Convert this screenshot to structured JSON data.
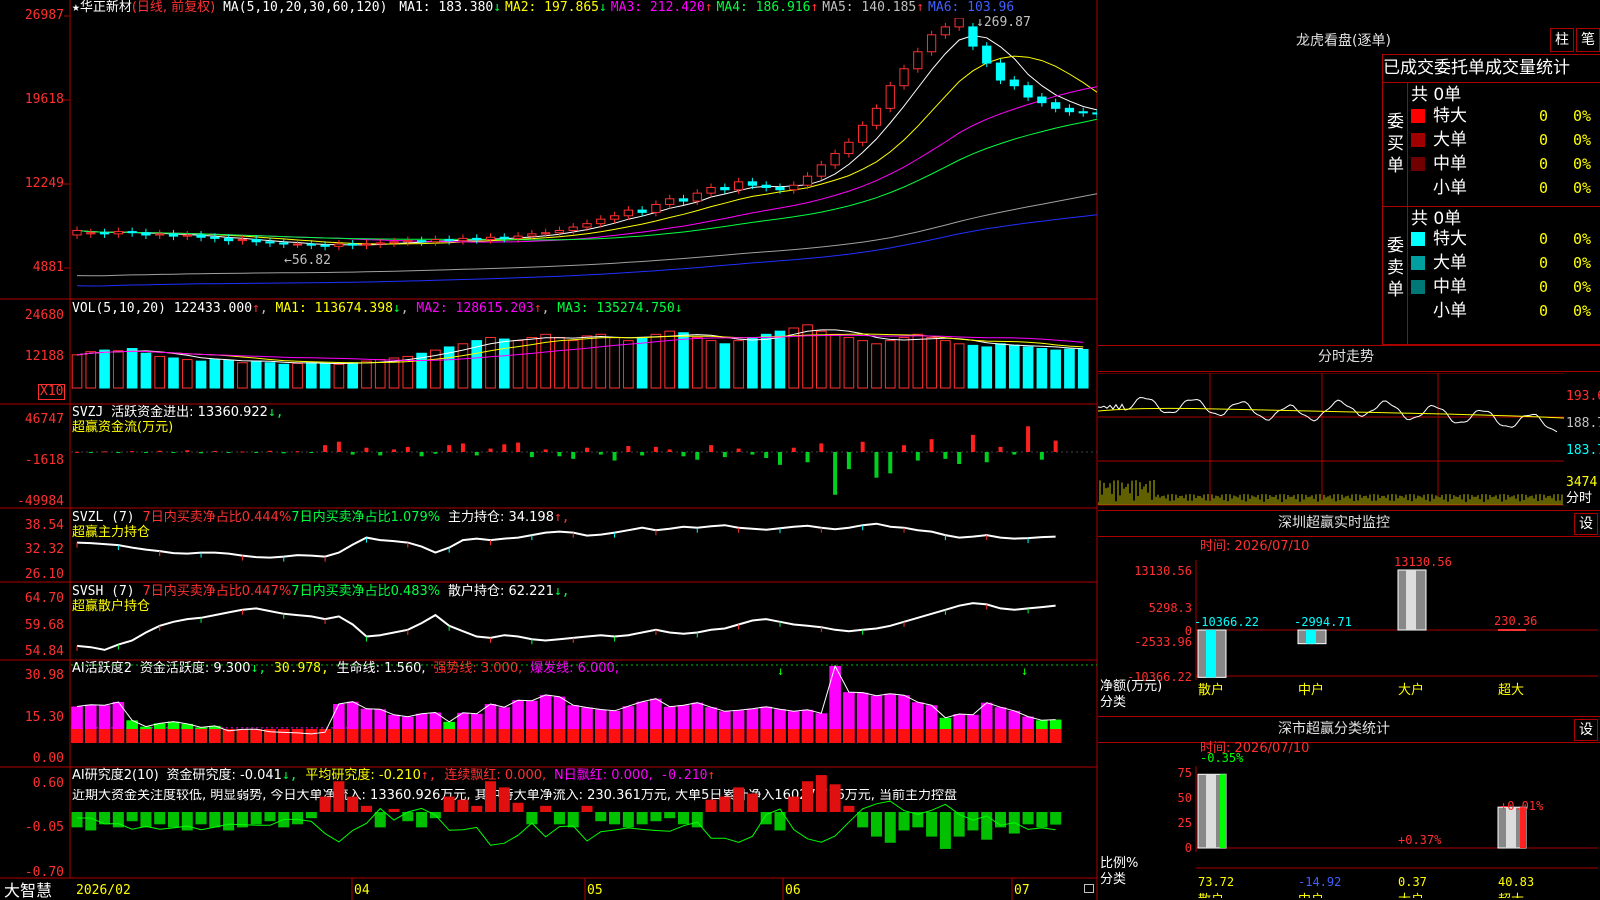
{
  "stock": {
    "name": "华正新材",
    "mode": "(日线, 前复权)",
    "star": "★"
  },
  "ma_line": {
    "head": "MA(5,10,20,30,60,120)",
    "items": [
      {
        "label": "MA1: 183.380",
        "arrow": "↓",
        "color": "#ffffff"
      },
      {
        "label": "MA2: 197.865",
        "arrow": "↓",
        "color": "#ffff00"
      },
      {
        "label": "MA3: 212.420",
        "arrow": "↑",
        "color": "#ff00ff"
      },
      {
        "label": "MA4: 186.916",
        "arrow": "↑",
        "color": "#00ff40"
      },
      {
        "label": "MA5: 140.185",
        "arrow": "↑",
        "color": "#c0c0c0"
      },
      {
        "label": "MA6: 103.96",
        "arrow": "",
        "color": "#4060ff"
      }
    ]
  },
  "price_axis": [
    "26987",
    "19618",
    "12249",
    "4881"
  ],
  "price_annot": {
    "high": "269.87",
    "low": "56.82"
  },
  "vol": {
    "head": "VOL(5,10,20)",
    "value": "122433.000",
    "value_arrow": "↑",
    "ma1": "MA1: 113674.398",
    "ma1_arrow": "↓",
    "ma2": "MA2: 128615.203",
    "ma2_arrow": "↑",
    "ma3": "MA3: 135274.750",
    "ma3_arrow": "↓",
    "axis": [
      "24680",
      "12188"
    ],
    "scale": "X10"
  },
  "svzj": {
    "name": "SVZJ",
    "text": "活跃资金进出: 13360.922",
    "arrow": "↓,",
    "sub": "超赢资金流(万元)",
    "axis": [
      "46747",
      "-1618",
      "-49984"
    ]
  },
  "svzl": {
    "name": "SVZL (7)",
    "t1": "7日内买卖净占比0.444%",
    "t2": "7日内买卖净占比1.079%",
    "t3": "主力持仓: 34.198",
    "arrow": "↑,",
    "sub": "超赢主力持仓",
    "axis": [
      "38.54",
      "32.32",
      "26.10"
    ]
  },
  "svsh": {
    "name": "SVSH (7)",
    "t1": "7日内买卖净占比0.447%",
    "t2": "7日内买卖净占比0.483%",
    "t3": "散户持仓: 62.221",
    "arrow": "↓,",
    "sub": "超赢散户持仓",
    "axis": [
      "64.70",
      "59.68",
      "54.84"
    ]
  },
  "ai1": {
    "name": "AI活跃度2",
    "t1": "资金活跃度: 9.300",
    "a1": "↓,",
    "t2": "30.978,",
    "t3": "生命线: 1.560,",
    "t4": "强势线: 3.000,",
    "t5": "爆发线: 6.000,",
    "axis": [
      "30.98",
      "15.30",
      "0.00"
    ]
  },
  "ai2": {
    "name": "AI研究度2(10)",
    "t1": "资金研究度: -0.041",
    "a1": "↓,",
    "t2": "平均研究度: -0.210",
    "a2": "↑,",
    "t3": "连续飘红: 0.000,",
    "t4": "N日飘红: 0.000,",
    "t5": "-0.210",
    "a5": "↑",
    "comment": "近期大资金关注度较低, 明显弱势, 今日大单净流入: 13360.926万元, 其中特大单净流入: 230.361万元, 大单5日累计净入16027.716万元, 当前主力控盘",
    "axis": [
      "0.60",
      "-0.05",
      "-0.70"
    ]
  },
  "date_axis": {
    "brand": "大智慧",
    "labels": [
      "2026/02",
      "04",
      "05",
      "06",
      "07"
    ]
  },
  "right": {
    "lhb_title": "龙虎看盘(逐单)",
    "btn_zhu": "柱",
    "btn_bi": "笔",
    "table_title": "已成交委托单成交量统计",
    "buy_label": [
      "委",
      "买",
      "单"
    ],
    "sell_label": [
      "委",
      "卖",
      "单"
    ],
    "buy_count": "共 0单",
    "sell_count": "共 0单",
    "buy_rows": [
      {
        "name": "特大",
        "color": "#ff0000",
        "val": "0",
        "pct": "0%"
      },
      {
        "name": "大单",
        "color": "#a00000",
        "val": "0",
        "pct": "0%"
      },
      {
        "name": "中单",
        "color": "#700000",
        "val": "0",
        "pct": "0%"
      },
      {
        "name": "小单",
        "color": "",
        "val": "0",
        "pct": "0%"
      }
    ],
    "sell_rows": [
      {
        "name": "特大",
        "color": "#00ffff",
        "val": "0",
        "pct": "0%"
      },
      {
        "name": "大单",
        "color": "#00a0a0",
        "val": "0",
        "pct": "0%"
      },
      {
        "name": "中单",
        "color": "#007878",
        "val": "0",
        "pct": "0%"
      },
      {
        "name": "小单",
        "color": "",
        "val": "0",
        "pct": "0%"
      }
    ],
    "intraday_title": "分时走势",
    "intraday_axis": [
      "193.6",
      "188.7",
      "183.7",
      "3474",
      "分时"
    ],
    "sz_monitor": {
      "title": "深圳超赢实时监控",
      "btn": "设",
      "time": "时间: 2026/07/10",
      "axis": [
        "13130.56",
        "5298.3",
        "0",
        "-2533.96",
        "-10366.22"
      ],
      "vals": [
        "-10366.22",
        "-2994.71",
        "13130.56",
        "230.36"
      ],
      "cats": [
        "散户",
        "中户",
        "大户",
        "超大"
      ],
      "ylabel": "净额(万元)",
      "xlabel": "分类"
    },
    "sz_class": {
      "title": "深市超赢分类统计",
      "btn": "设",
      "time": "时间: 2026/07/10",
      "axis": [
        "75",
        "50",
        "25",
        "0"
      ],
      "pct": [
        "-0.35%",
        "+0.37%",
        "+0.01%"
      ],
      "vals": [
        "73.72",
        "-14.92",
        "0.37",
        "40.83"
      ],
      "cats": [
        "散户",
        "中户",
        "大户",
        "超大"
      ],
      "ylabel": "比例%",
      "xlabel": "分类"
    }
  },
  "chart_data": [
    {
      "type": "candlestick",
      "title": "华正新材 (日线, 前复权)",
      "ylim": [
        48.81,
        269.87
      ],
      "candles": [
        [
          78,
          82
        ],
        [
          79,
          80
        ],
        [
          80,
          79
        ],
        [
          79,
          81
        ],
        [
          81,
          80
        ],
        [
          80,
          78
        ],
        [
          78,
          79
        ],
        [
          79,
          77
        ],
        [
          77,
          78
        ],
        [
          78,
          76
        ],
        [
          76,
          75
        ],
        [
          75,
          73
        ],
        [
          73,
          74
        ],
        [
          74,
          72
        ],
        [
          72,
          71
        ],
        [
          71,
          70
        ],
        [
          70,
          70
        ],
        [
          70,
          69
        ],
        [
          69,
          68
        ],
        [
          68,
          70
        ],
        [
          70,
          69
        ],
        [
          69,
          70
        ],
        [
          70,
          71
        ],
        [
          71,
          72
        ],
        [
          72,
          73
        ],
        [
          73,
          72
        ],
        [
          72,
          74
        ],
        [
          74,
          73
        ],
        [
          73,
          75
        ],
        [
          75,
          74
        ],
        [
          74,
          76
        ],
        [
          76,
          75
        ],
        [
          75,
          77
        ],
        [
          77,
          79
        ],
        [
          79,
          80
        ],
        [
          80,
          82
        ],
        [
          82,
          85
        ],
        [
          85,
          88
        ],
        [
          88,
          92
        ],
        [
          92,
          95
        ],
        [
          95,
          100
        ],
        [
          100,
          98
        ],
        [
          98,
          105
        ],
        [
          105,
          110
        ],
        [
          110,
          108
        ],
        [
          108,
          115
        ],
        [
          115,
          120
        ],
        [
          120,
          118
        ],
        [
          118,
          125
        ],
        [
          125,
          122
        ],
        [
          122,
          120
        ],
        [
          120,
          118
        ],
        [
          118,
          122
        ],
        [
          122,
          130
        ],
        [
          130,
          140
        ],
        [
          140,
          150
        ],
        [
          150,
          160
        ],
        [
          160,
          175
        ],
        [
          175,
          190
        ],
        [
          190,
          210
        ],
        [
          210,
          225
        ],
        [
          225,
          240
        ],
        [
          240,
          255
        ],
        [
          255,
          262
        ],
        [
          262,
          269.87
        ],
        [
          262,
          245
        ],
        [
          245,
          230
        ],
        [
          230,
          215
        ],
        [
          215,
          210
        ],
        [
          210,
          200
        ],
        [
          200,
          195
        ],
        [
          195,
          190
        ],
        [
          190,
          187
        ],
        [
          187,
          186
        ],
        [
          186,
          185
        ]
      ]
    },
    {
      "type": "bar",
      "title": "VOL(5,10,20)",
      "series": [
        {
          "name": "VOL",
          "values": [
            10.5,
            11.5,
            12.0,
            11.8,
            12.5,
            11.0,
            10.0,
            9.5,
            9.0,
            8.5,
            9.0,
            8.8,
            8.0,
            8.5,
            8.0,
            7.5,
            7.8,
            8.0,
            7.8,
            7.5,
            8.0,
            8.5,
            9.0,
            9.5,
            10.0,
            11.0,
            12.0,
            13.0,
            14.0,
            15.0,
            16.0,
            15.5,
            15.0,
            16.0,
            17.0,
            16.0,
            15.0,
            16.5,
            17.0,
            16.0,
            15.0,
            16.0,
            17.0,
            18.0,
            17.5,
            16.0,
            15.0,
            14.0,
            15.0,
            16.0,
            17.0,
            18.0,
            19.0,
            20.0,
            18.0,
            17.0,
            16.0,
            15.0,
            14.0,
            15.0,
            16.0,
            17.0,
            16.0,
            15.0,
            14.0,
            13.5,
            13.0,
            14.0,
            13.5,
            13.0,
            12.5,
            12.0,
            12.3,
            12.2
          ]
        }
      ]
    },
    {
      "type": "bar",
      "title": "SVZJ",
      "series": [
        {
          "name": "SVZJ",
          "values": [
            200,
            -600,
            800,
            -1200,
            1000,
            -900,
            1500,
            -1000,
            2000,
            -1500,
            1200,
            -800,
            600,
            -700,
            1400,
            -1600,
            900,
            -500,
            8000,
            12000,
            -3000,
            5000,
            -4000,
            3000,
            6000,
            -5000,
            -2000,
            8000,
            10000,
            -4000,
            4000,
            9000,
            11000,
            -6000,
            3000,
            -5000,
            -8000,
            5000,
            -3000,
            -10000,
            7000,
            -4000,
            6000,
            3000,
            -5000,
            -9000,
            8000,
            -6000,
            4000,
            -3000,
            -7000,
            -15000,
            5000,
            -12000,
            10000,
            -49984,
            -20000,
            12000,
            -30000,
            -25000,
            8000,
            -10000,
            15000,
            -8000,
            -14000,
            20000,
            -12000,
            6000,
            -3000,
            30000,
            -9000,
            13360
          ]
        }
      ]
    },
    {
      "type": "line",
      "title": "SVZL",
      "series": [
        {
          "name": "主力持仓",
          "values": [
            33.0,
            32.9,
            32.7,
            32.5,
            32.0,
            31.6,
            31.3,
            30.9,
            30.8,
            31.0,
            31.0,
            30.8,
            30.4,
            30.1,
            30.0,
            30.2,
            30.5,
            30.4,
            30.2,
            31.0,
            32.6,
            34.0,
            33.5,
            33.3,
            33.0,
            32.2,
            31.0,
            32.0,
            33.5,
            33.8,
            33.5,
            33.8,
            34.0,
            34.5,
            35.0,
            35.2,
            35.0,
            34.4,
            34.6,
            35.0,
            35.5,
            36.0,
            35.5,
            35.8,
            36.2,
            36.0,
            36.3,
            36.5,
            36.0,
            35.8,
            35.6,
            35.9,
            36.2,
            36.4,
            36.0,
            35.7,
            36.0,
            36.5,
            36.8,
            36.2,
            36.0,
            35.5,
            35.2,
            34.5,
            34.0,
            34.2,
            34.5,
            34.0,
            33.8,
            33.9,
            34.1,
            34.198
          ]
        }
      ]
    },
    {
      "type": "line",
      "title": "SVSH",
      "series": [
        {
          "name": "散户持仓",
          "values": [
            56.2,
            56.0,
            55.6,
            56.4,
            57.0,
            58.2,
            59.2,
            59.8,
            60.2,
            60.4,
            60.8,
            61.2,
            61.6,
            61.8,
            61.4,
            61.0,
            60.8,
            60.6,
            60.2,
            60.6,
            59.4,
            57.6,
            57.8,
            58.2,
            58.6,
            59.6,
            60.8,
            59.2,
            58.4,
            57.6,
            57.4,
            57.8,
            57.6,
            57.2,
            57.0,
            57.2,
            57.4,
            57.6,
            57.8,
            57.6,
            57.8,
            58.2,
            58.6,
            58.2,
            58.0,
            58.2,
            58.6,
            58.8,
            59.4,
            60.0,
            60.2,
            59.8,
            59.4,
            59.2,
            59.0,
            58.6,
            58.4,
            58.6,
            58.8,
            59.2,
            59.8,
            60.4,
            61.0,
            61.6,
            62.2,
            62.6,
            62.4,
            61.8,
            61.6,
            61.8,
            62.0,
            62.221
          ]
        }
      ]
    },
    {
      "type": "bar",
      "title": "AI活跃度2",
      "series": [
        {
          "name": "资金活跃度",
          "values": [
            14.5,
            15.2,
            15.0,
            16.3,
            9.0,
            6.5,
            7.8,
            8.5,
            7.6,
            6.2,
            6.8,
            4.8,
            5.4,
            5.5,
            4.5,
            4.2,
            4.0,
            3.6,
            4.3,
            15.5,
            16.4,
            13.6,
            13.4,
            11.2,
            10.4,
            11.6,
            12.1,
            8.4,
            12.0,
            11.6,
            15.5,
            14.2,
            17.0,
            16.8,
            19.1,
            18.4,
            15.0,
            14.1,
            13.3,
            12.8,
            14.6,
            16.4,
            17.6,
            14.4,
            15.0,
            16.0,
            14.2,
            12.6,
            13.0,
            13.6,
            14.4,
            13.4,
            12.6,
            13.2,
            11.8,
            30.6,
            20.2,
            20.0,
            18.8,
            19.6,
            19.0,
            16.2,
            15.0,
            10.0,
            11.5,
            11.2,
            16.0,
            14.2,
            12.8,
            10.5,
            9.0,
            9.3
          ]
        }
      ]
    },
    {
      "type": "bar",
      "title": "AI研究度2(10)",
      "series": [
        {
          "name": "资金研究度",
          "values": [
            -0.05,
            -0.06,
            -0.04,
            -0.05,
            -0.03,
            -0.05,
            -0.04,
            -0.05,
            -0.06,
            -0.04,
            -0.05,
            -0.06,
            -0.05,
            -0.04,
            -0.03,
            -0.05,
            -0.04,
            -0.02,
            0.05,
            0.1,
            0.05,
            0.02,
            -0.05,
            0.01,
            -0.03,
            -0.05,
            -0.02,
            0.05,
            0.04,
            0.02,
            0.1,
            0.08,
            0.03,
            -0.04,
            0.02,
            -0.04,
            -0.05,
            0.02,
            -0.03,
            -0.04,
            -0.05,
            -0.04,
            -0.03,
            -0.02,
            -0.04,
            -0.05,
            0.04,
            0.05,
            0.08,
            0.06,
            -0.04,
            -0.06,
            0.05,
            0.1,
            0.12,
            0.09,
            0.02,
            -0.05,
            -0.08,
            -0.1,
            -0.06,
            -0.05,
            -0.08,
            -0.12,
            -0.08,
            -0.06,
            -0.09,
            -0.05,
            -0.07,
            -0.04,
            -0.05,
            -0.041
          ]
        }
      ]
    }
  ]
}
